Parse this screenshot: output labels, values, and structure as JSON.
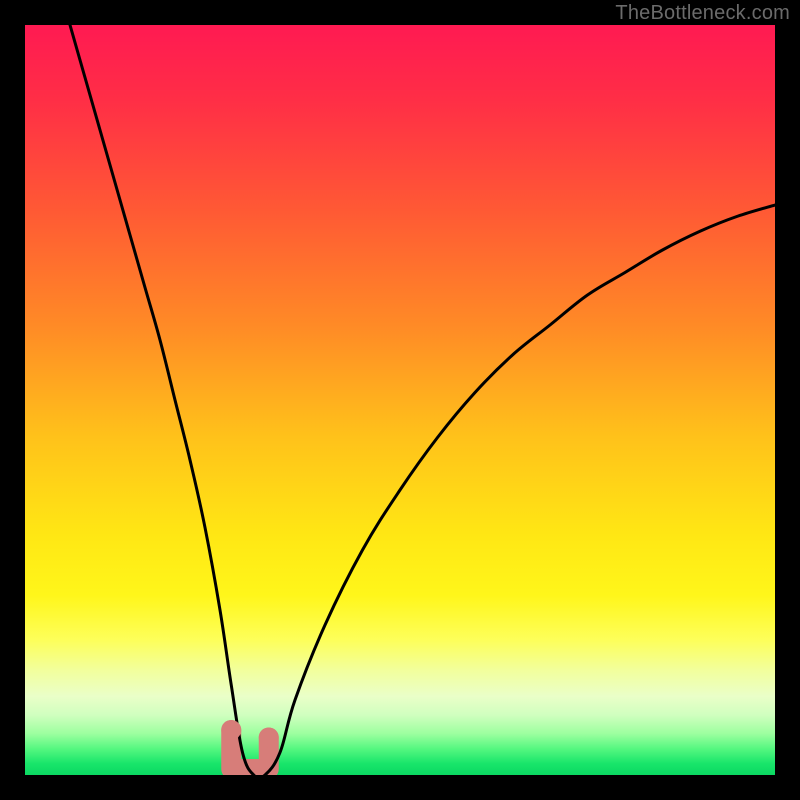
{
  "watermark": "TheBottleneck.com",
  "colors": {
    "frame": "#000000",
    "marker": "#d77d79",
    "curve": "#000000",
    "watermark": "#6b6b6b"
  },
  "chart_data": {
    "type": "line",
    "title": "",
    "xlabel": "",
    "ylabel": "",
    "xlim": [
      0,
      100
    ],
    "ylim": [
      0,
      100
    ],
    "grid": false,
    "series": [
      {
        "name": "bottleneck-curve",
        "x": [
          6,
          8,
          10,
          12,
          14,
          16,
          18,
          20,
          22,
          24,
          26,
          27.5,
          29,
          30.5,
          32,
          34,
          36,
          40,
          45,
          50,
          55,
          60,
          65,
          70,
          75,
          80,
          85,
          90,
          95,
          100
        ],
        "y": [
          100,
          93,
          86,
          79,
          72,
          65,
          58,
          50,
          42,
          33,
          22,
          12,
          3,
          0,
          0,
          3,
          10,
          20,
          30,
          38,
          45,
          51,
          56,
          60,
          64,
          67,
          70,
          72.5,
          74.5,
          76
        ]
      }
    ],
    "markers": [
      {
        "name": "highlight-left",
        "x": 27.5,
        "y": 6
      },
      {
        "name": "highlight-right",
        "x": 32.5,
        "y": 5
      }
    ],
    "gradient_stops": [
      {
        "pos": 0.0,
        "color": "#ff1a52"
      },
      {
        "pos": 0.1,
        "color": "#ff2e46"
      },
      {
        "pos": 0.25,
        "color": "#ff5a34"
      },
      {
        "pos": 0.4,
        "color": "#ff8a26"
      },
      {
        "pos": 0.55,
        "color": "#ffc21a"
      },
      {
        "pos": 0.68,
        "color": "#ffe714"
      },
      {
        "pos": 0.76,
        "color": "#fff61a"
      },
      {
        "pos": 0.82,
        "color": "#fdff5a"
      },
      {
        "pos": 0.86,
        "color": "#f2ff9c"
      },
      {
        "pos": 0.895,
        "color": "#eaffc8"
      },
      {
        "pos": 0.92,
        "color": "#d0ffbf"
      },
      {
        "pos": 0.945,
        "color": "#9cff9f"
      },
      {
        "pos": 0.965,
        "color": "#55f780"
      },
      {
        "pos": 0.985,
        "color": "#18e56a"
      },
      {
        "pos": 1.0,
        "color": "#0bd862"
      }
    ]
  }
}
